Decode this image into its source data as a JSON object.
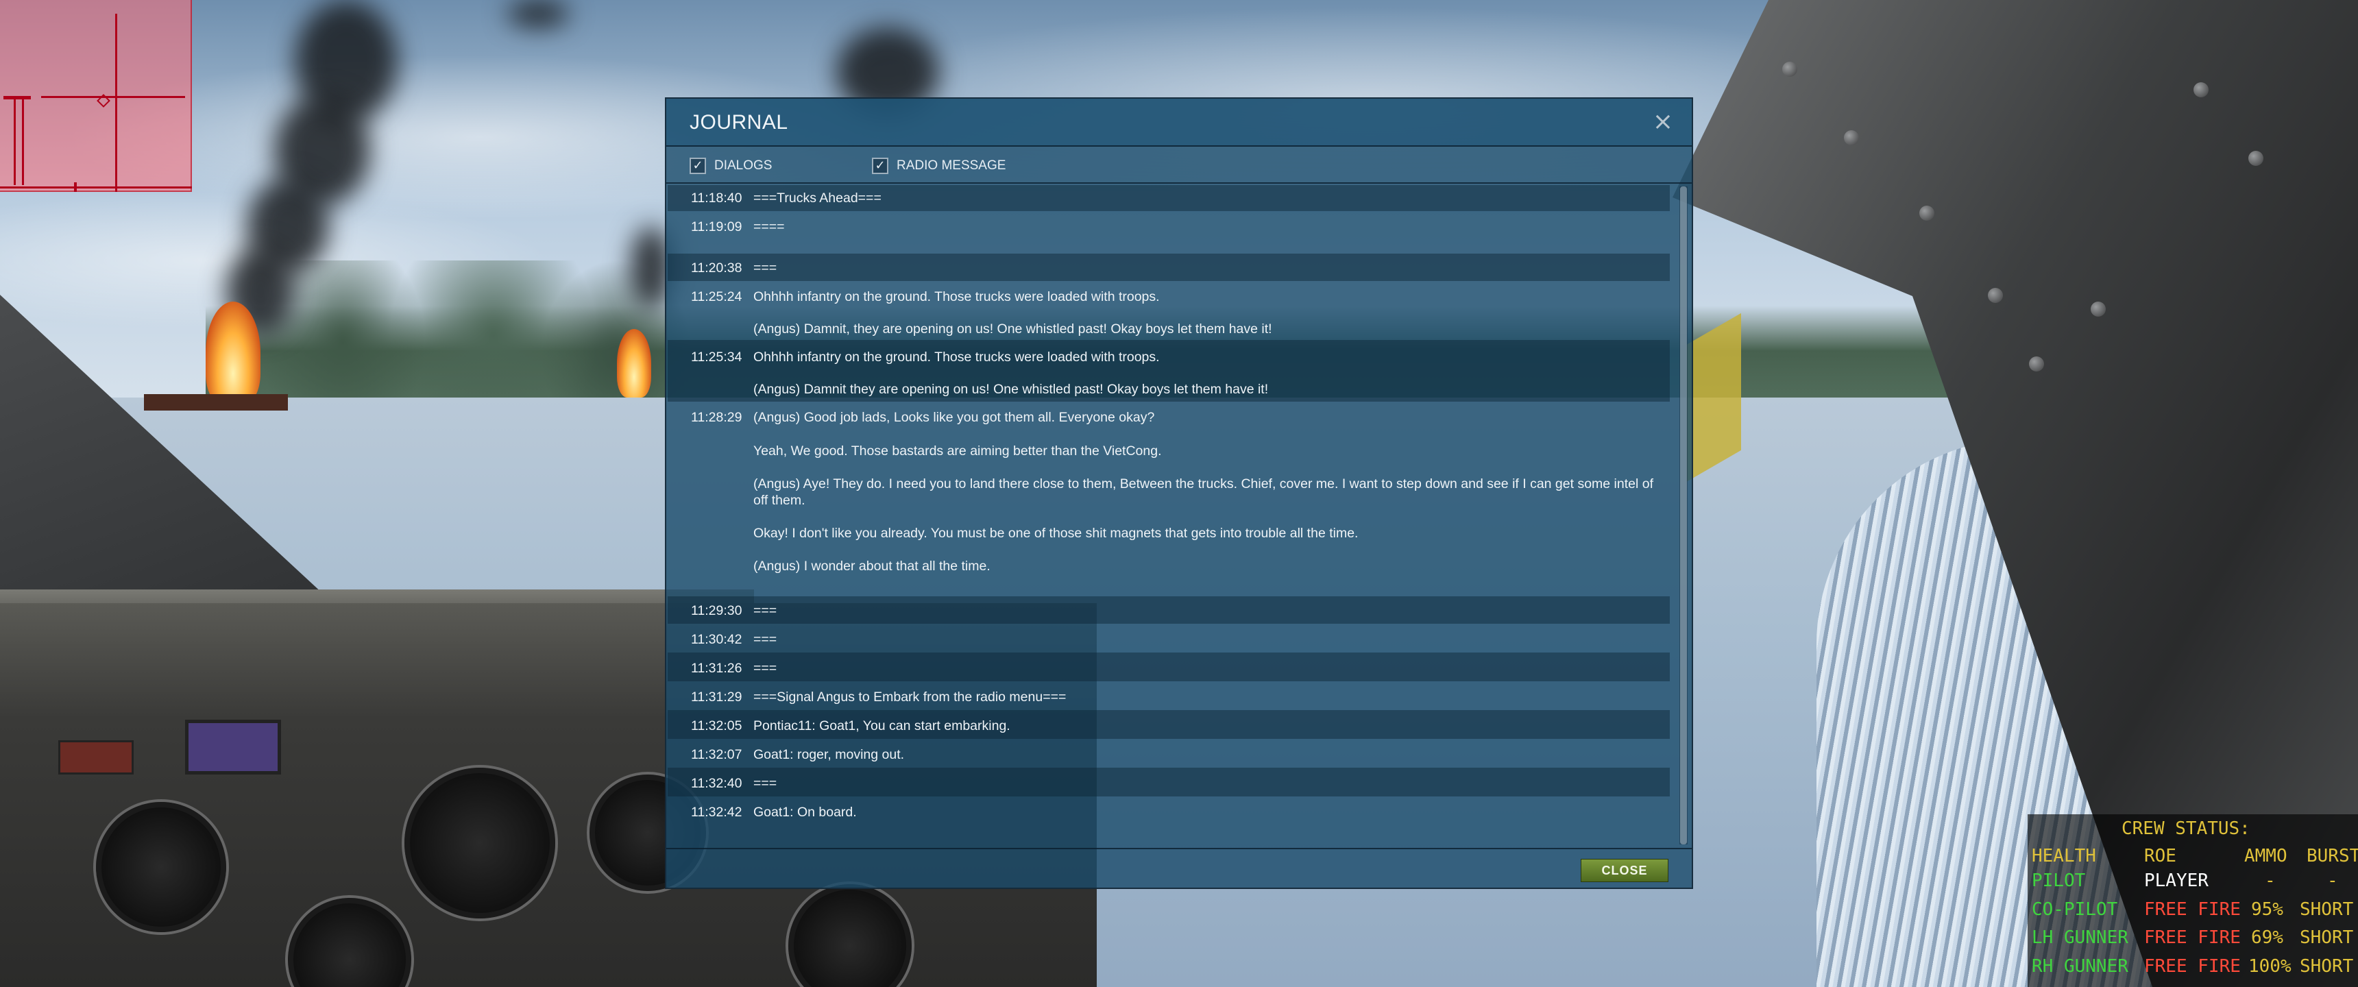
{
  "journal": {
    "title": "JOURNAL",
    "filters": [
      {
        "label": "DIALOGS",
        "checked": true
      },
      {
        "label": "RADIO MESSAGE",
        "checked": true
      }
    ],
    "entries": [
      {
        "time": "11:18:40",
        "text": "===Trucks Ahead==="
      },
      {
        "time": "11:19:09",
        "text": "===="
      },
      {
        "time": "11:20:38",
        "text": "==="
      },
      {
        "time": "11:25:24",
        "text": "Ohhhh infantry on the ground. Those trucks were loaded with troops.",
        "sub": [
          "(Angus) Damnit, they are opening on us! One whistled past! Okay boys let them have it!"
        ]
      },
      {
        "time": "11:25:34",
        "text": "Ohhhh infantry on the ground. Those trucks were loaded with troops.",
        "sub": [
          "(Angus) Damnit they are opening on us! One whistled past! Okay boys let them have it!"
        ]
      },
      {
        "time": "11:28:29",
        "text": "(Angus) Good job lads, Looks like you got them all. Everyone okay?",
        "sub": [
          "Yeah, We good. Those bastards are aiming better than the VietCong.",
          "(Angus) Aye! They do. I need you to land there close to them, Between the trucks. Chief, cover me. I want to step down and see if I can get some intel of off them.",
          "Okay! I don't like you already. You must be one of those shit magnets that gets into trouble all the time.",
          "(Angus) I wonder about that all the time."
        ]
      },
      {
        "time": "11:29:30",
        "text": "==="
      },
      {
        "time": "11:30:42",
        "text": "==="
      },
      {
        "time": "11:31:26",
        "text": "==="
      },
      {
        "time": "11:31:29",
        "text": "===Signal Angus to Embark from the radio menu==="
      },
      {
        "time": "11:32:05",
        "text": "Pontiac11: Goat1, You can start embarking."
      },
      {
        "time": "11:32:07",
        "text": "Goat1: roger, moving out."
      },
      {
        "time": "11:32:40",
        "text": "==="
      },
      {
        "time": "11:32:42",
        "text": "Goat1: On board."
      }
    ],
    "close_button": "CLOSE",
    "close_icon": "×"
  },
  "crew_status": {
    "title": "CREW STATUS:",
    "headers": {
      "health": "HEALTH",
      "roe": "ROE",
      "ammo": "AMMO",
      "burst": "BURST"
    },
    "rows": [
      {
        "name": "PILOT",
        "roe": "PLAYER",
        "ammo": "-",
        "burst": "-"
      },
      {
        "name": "CO-PILOT",
        "roe": "FREE FIRE",
        "ammo": "95%",
        "burst": "SHORT"
      },
      {
        "name": "LH GUNNER",
        "roe": "FREE FIRE",
        "ammo": "69%",
        "burst": "SHORT"
      },
      {
        "name": "RH GUNNER",
        "roe": "FREE FIRE",
        "ammo": "100%",
        "burst": "SHORT"
      }
    ],
    "colors": {
      "header": "#e0c23a",
      "name": "#3fd43f",
      "player": "#ffffff",
      "roe": "#ff4a3a",
      "ammo": "#e0c23a",
      "burst": "#e0c23a"
    }
  },
  "icons": {
    "checkbox": "check-icon",
    "close": "close-icon",
    "minimap": "minimap-icon"
  }
}
